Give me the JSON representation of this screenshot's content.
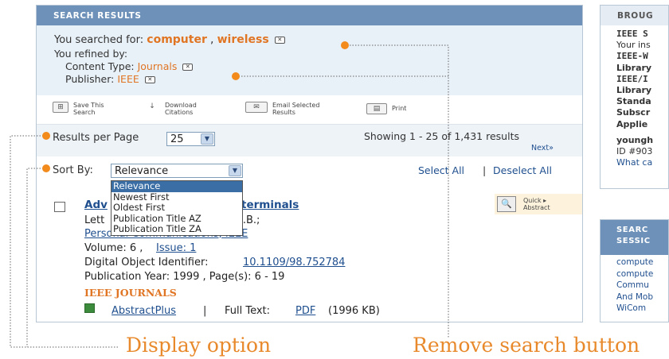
{
  "header": {
    "title": "SEARCH RESULTS"
  },
  "search": {
    "searched_label": "You searched for:",
    "term1": "computer",
    "separator": ",",
    "term2": "wireless",
    "refined_label": "You refined by:",
    "content_type_label": "Content Type:",
    "content_type_value": "Journals",
    "publisher_label": "Publisher:",
    "publisher_value": "IEEE"
  },
  "toolbar": {
    "save_line1": "Save This",
    "save_line2": "Search",
    "download_line1": "Download",
    "download_line2": "Citations",
    "email_line1": "Email Selected",
    "email_line2": "Results",
    "print": "Print"
  },
  "results_per_page": {
    "label": "Results per Page",
    "value": "25"
  },
  "showing": {
    "text": "Showing 1 - 25 of 1,431 results",
    "next": "Next»"
  },
  "sort": {
    "label": "Sort By:",
    "value": "Relevance",
    "options": [
      "Relevance",
      "Newest First",
      "Oldest First",
      "Publication Title AZ",
      "Publication Title ZA"
    ]
  },
  "select_all": "Select All",
  "select_sep": "|",
  "deselect_all": "Deselect All",
  "result": {
    "title_start": "Adv",
    "title_end": "terminals",
    "letters_prefix": "Lett",
    "letters_suffix": "I.B.;",
    "publication": "Personal Communications, IEEE",
    "volume_label": "Volume: 6 ,",
    "issue": "Issue: 1",
    "doi_label": "Digital Object Identifier:",
    "doi": "10.1109/98.752784",
    "year": "Publication Year: 1999 , Page(s): 6 - 19",
    "source": "IEEE JOURNALS",
    "abstract_plus": "AbstractPlus",
    "sep": "|",
    "full_text_label": "Full Text:",
    "pdf": "PDF",
    "pdf_size": "(1996 KB)",
    "quick_abstract_line1": "Quick ▸",
    "quick_abstract_line2": "Abstract"
  },
  "right_panel": {
    "header": "BROUG",
    "lines": [
      "IEEE S",
      "Your ins",
      "IEEE-W",
      "Library",
      "IEEE/I",
      "Library",
      "Standa",
      "Subscr",
      "Applie"
    ],
    "user": "youngh",
    "id": "ID #903",
    "what": "What ca"
  },
  "right_panel2": {
    "header": "SEARC",
    "header2": "SESSIC",
    "items": [
      "compute",
      "compute",
      "Commu",
      "And Mob",
      "WiCom"
    ]
  },
  "callouts": {
    "display": "Display option",
    "remove": "Remove search button"
  },
  "colors": {
    "accent": "#e07524",
    "header": "#6d91b8",
    "callout": "#e8892c",
    "bubble": "#f28a1c"
  }
}
